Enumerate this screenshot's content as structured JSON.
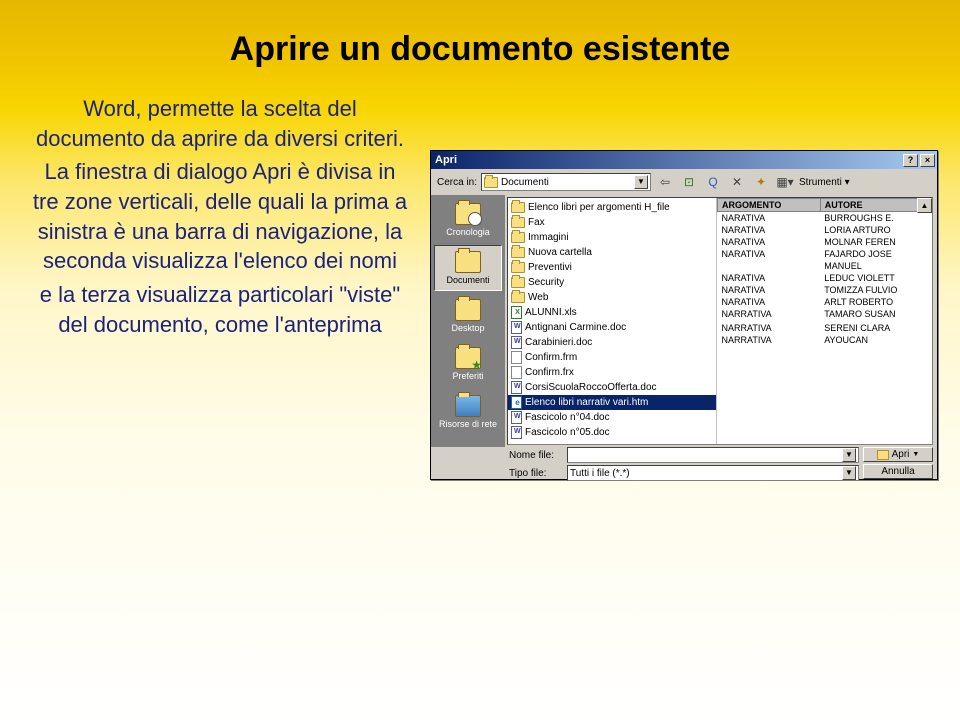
{
  "slide": {
    "title": "Aprire un documento esistente",
    "p1": "Word, permette la scelta del documento da aprire da diversi criteri.",
    "p2": "La finestra di dialogo Apri è divisa in tre zone verticali, delle quali la prima a sinistra è una barra di navigazione, la seconda visualizza l'elenco dei nomi",
    "p3": "e la terza visualizza particolari \"viste\" del documento, come l'anteprima"
  },
  "dialog": {
    "title": "Apri",
    "lookin_label": "Cerca in:",
    "lookin_value": "Documenti",
    "tools_label": "Strumenti",
    "places": [
      {
        "label": "Cronologia"
      },
      {
        "label": "Documenti"
      },
      {
        "label": "Desktop"
      },
      {
        "label": "Preferiti"
      },
      {
        "label": "Risorse di rete"
      }
    ],
    "files": [
      {
        "icon": "folder",
        "name": "Elenco libri per argomenti H_file"
      },
      {
        "icon": "folder",
        "name": "Fax"
      },
      {
        "icon": "folder",
        "name": "Immagini"
      },
      {
        "icon": "folder",
        "name": "Nuova cartella"
      },
      {
        "icon": "folder",
        "name": "Preventivi"
      },
      {
        "icon": "folder",
        "name": "Security"
      },
      {
        "icon": "folder",
        "name": "Web"
      },
      {
        "icon": "xls",
        "name": "ALUNNI.xls"
      },
      {
        "icon": "doc",
        "name": "Antignani Carmine.doc"
      },
      {
        "icon": "doc",
        "name": "Carabinieri.doc"
      },
      {
        "icon": "gen",
        "name": "Confirm.frm"
      },
      {
        "icon": "gen",
        "name": "Confirm.frx"
      },
      {
        "icon": "doc",
        "name": "CorsiScuolaRoccoOfferta.doc"
      },
      {
        "icon": "htm",
        "name": "Elenco libri narrativ vari.htm"
      },
      {
        "icon": "doc",
        "name": "Fascicolo n°04.doc"
      },
      {
        "icon": "doc",
        "name": "Fascicolo n°05.doc"
      }
    ],
    "selected_index": 13,
    "preview": {
      "headers": [
        "ARGOMENTO",
        "AUTORE"
      ],
      "rows": [
        [
          "NARATIVA",
          "BURROUGHS E."
        ],
        [
          "NARATIVA",
          "LORIA ARTURO"
        ],
        [
          "NARATIVA",
          "MOLNAR FEREN"
        ],
        [
          "NARATIVA",
          "FAJARDO JOSE"
        ],
        [
          "",
          "MANUEL"
        ],
        [
          "NARATIVA",
          "LEDUC VIOLETT"
        ],
        [
          "NARATIVA",
          "TOMIZZA FULVIO"
        ],
        [
          "NARATIVA",
          "ARLT ROBERTO"
        ],
        [
          "NARRATIVA",
          "TAMARO SUSAN"
        ],
        [
          "",
          ""
        ],
        [
          "NARRATIVA",
          "SERENI CLARA"
        ],
        [
          "NARRATIVA",
          "AYOUCAN"
        ]
      ]
    },
    "filename_label": "Nome file:",
    "filename_value": "",
    "filetype_label": "Tipo file:",
    "filetype_value": "Tutti i file (*.*)",
    "open_btn": "Apri",
    "cancel_btn": "Annulla"
  }
}
